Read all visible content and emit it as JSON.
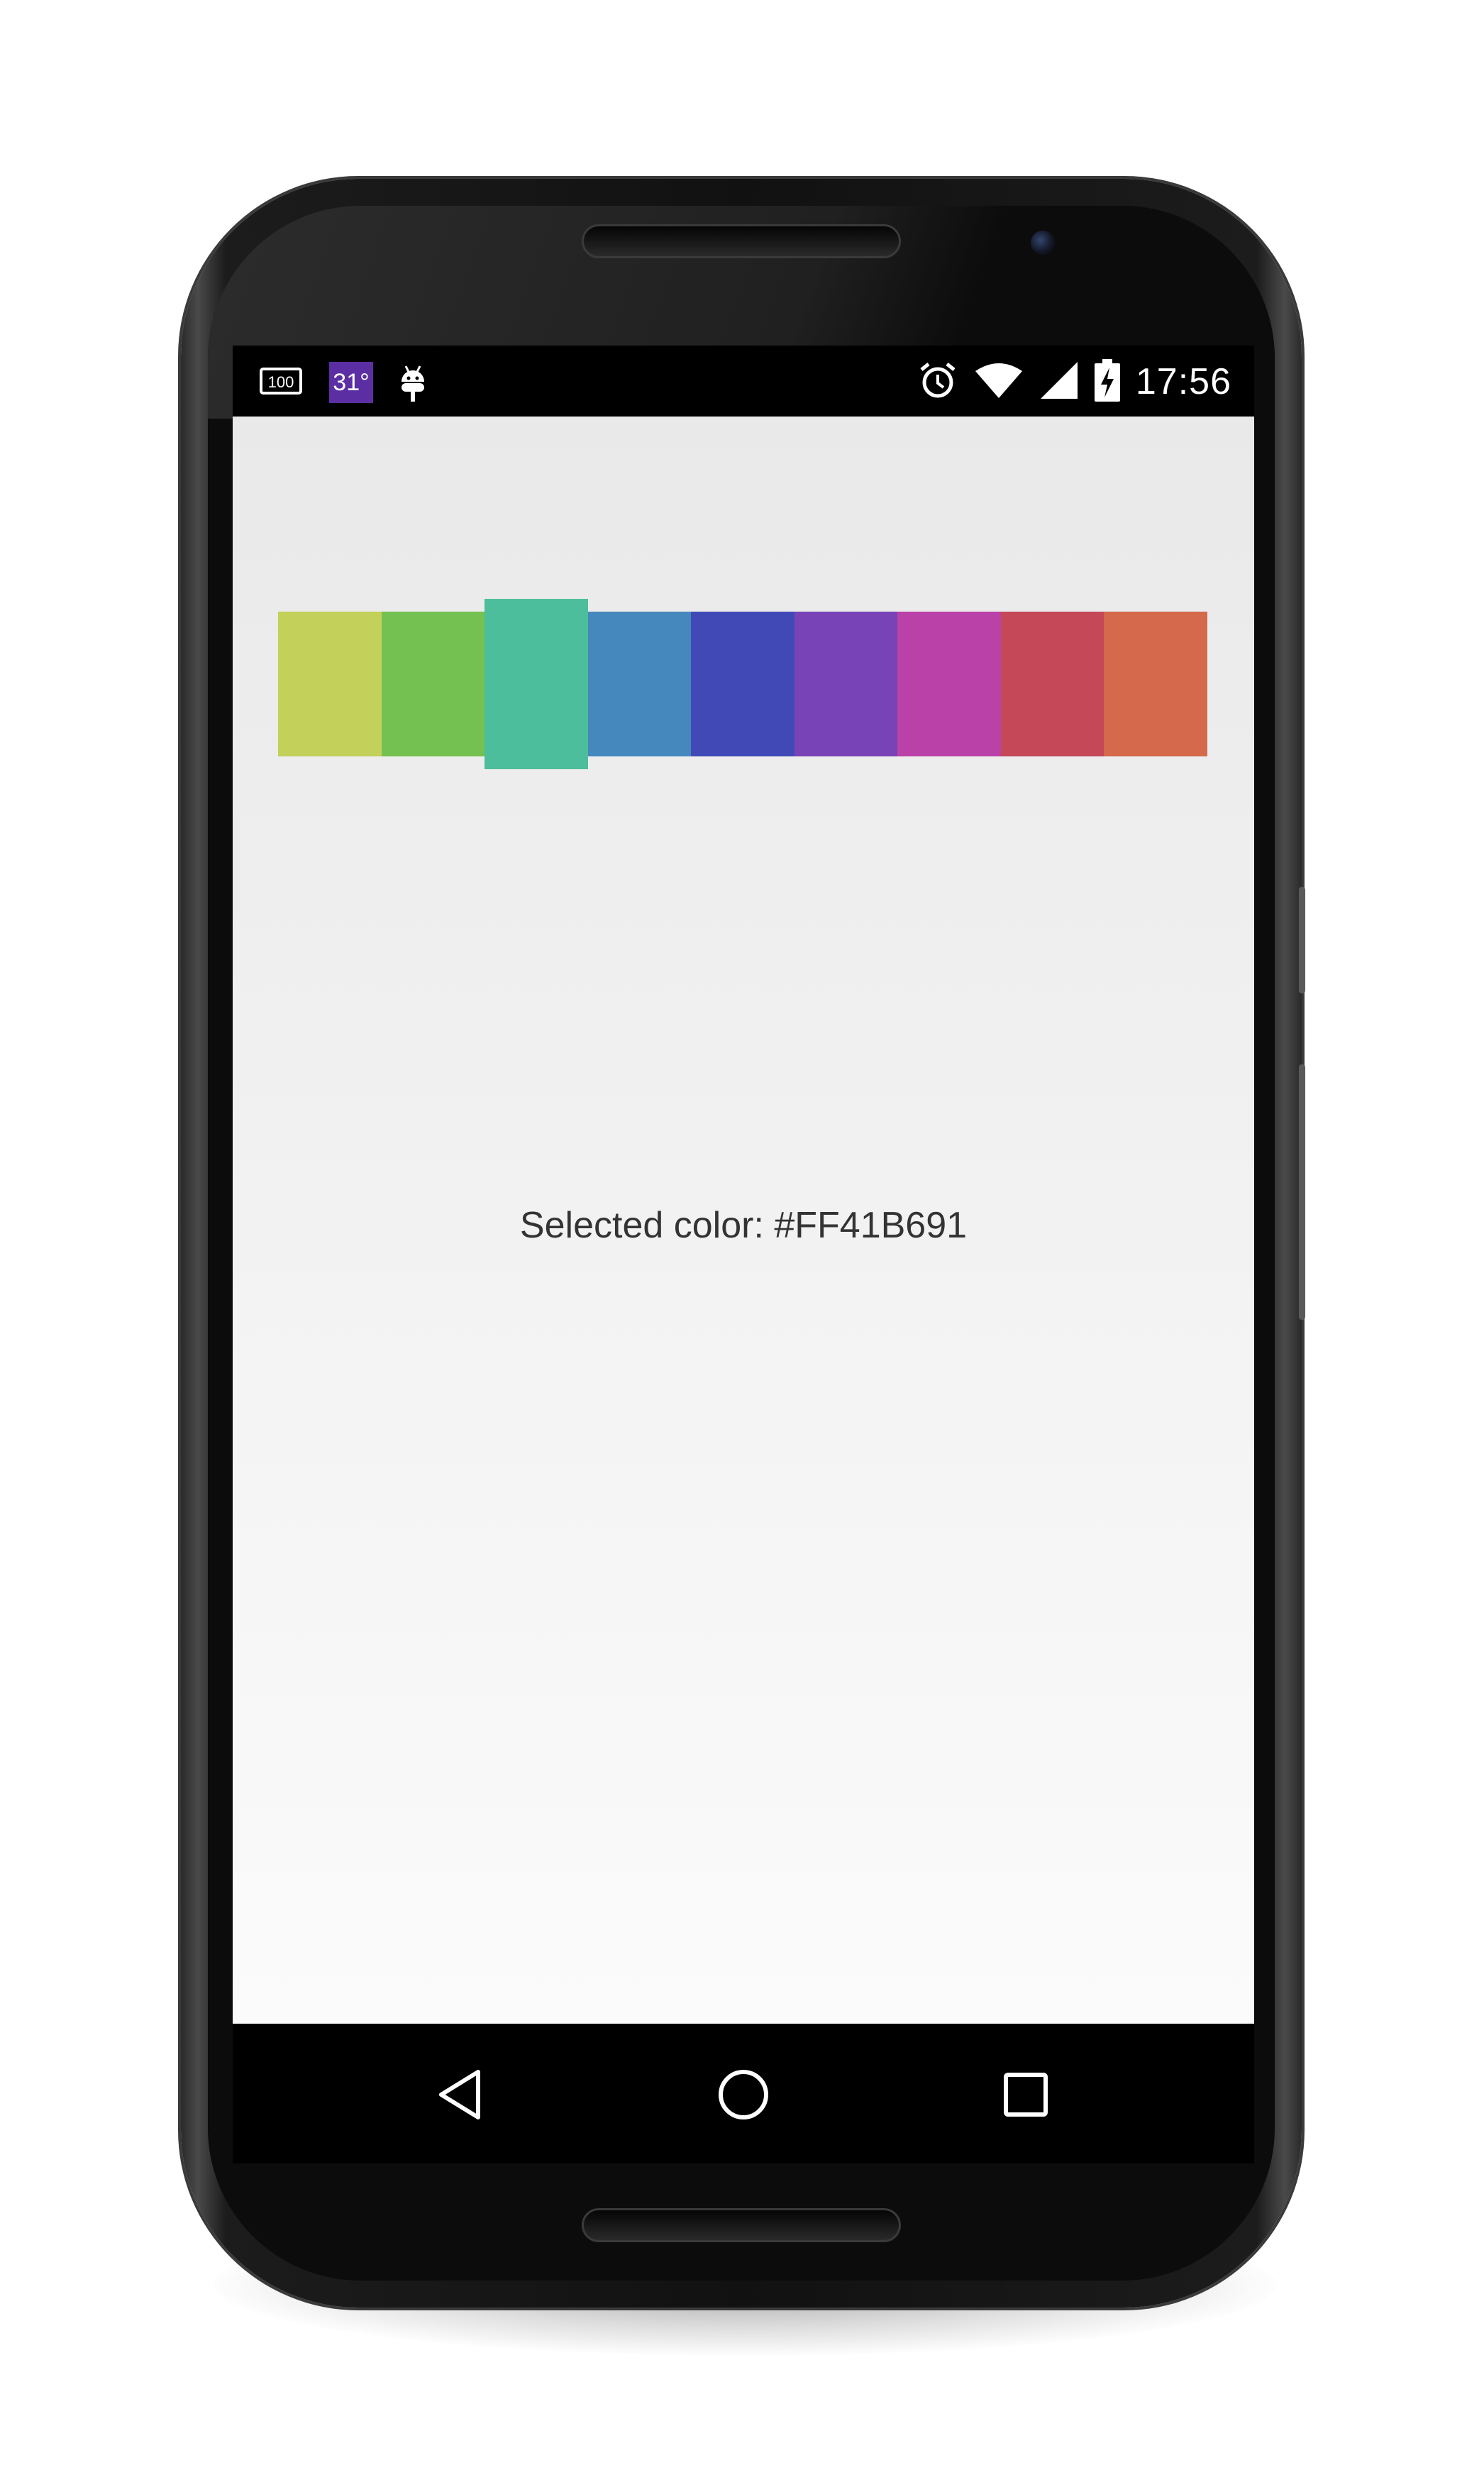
{
  "status_bar": {
    "left_icons": [
      "screenshot-storage-icon",
      "weather-icon",
      "android-debug-icon"
    ],
    "weather_temp": "31°",
    "right_icons": [
      "alarm-icon",
      "wifi-icon",
      "cell-signal-icon",
      "battery-charging-icon"
    ],
    "time": "17:56"
  },
  "color_picker": {
    "swatches": [
      {
        "color": "#C3D05A",
        "selected": false
      },
      {
        "color": "#74C151",
        "selected": false
      },
      {
        "color": "#4CBE9C",
        "selected": true
      },
      {
        "color": "#4588BE",
        "selected": false
      },
      {
        "color": "#4049B6",
        "selected": false
      },
      {
        "color": "#7843B6",
        "selected": false
      },
      {
        "color": "#B941A8",
        "selected": false
      },
      {
        "color": "#C44858",
        "selected": false
      },
      {
        "color": "#D4694C",
        "selected": false
      }
    ]
  },
  "selected_color_text": "Selected color: #FF41B691",
  "nav_bar": {
    "buttons": [
      "back-icon",
      "home-icon",
      "recents-icon"
    ]
  }
}
